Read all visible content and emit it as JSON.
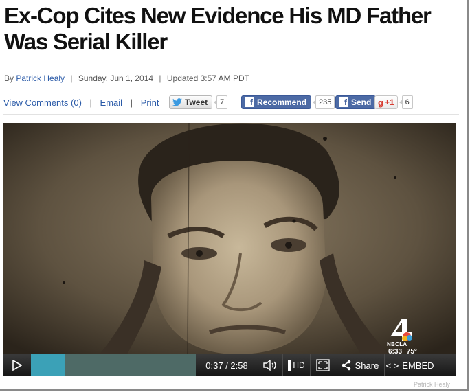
{
  "article": {
    "headline": "Ex-Cop Cites New Evidence His MD Father Was Serial Killer",
    "byline": {
      "by": "By",
      "author": "Patrick Healy",
      "date": "Sunday, Jun 1, 2014",
      "updated": "Updated 3:57 AM PDT"
    }
  },
  "actions": {
    "view_comments": "View Comments (0)",
    "email": "Email",
    "print": "Print",
    "separator": "|"
  },
  "social": {
    "tweet": {
      "label": "Tweet",
      "count": "7",
      "icon": "twitter-bird-icon"
    },
    "recommend": {
      "label": "Recommend",
      "count": "235",
      "icon": "facebook-icon"
    },
    "send": {
      "label": "Send",
      "icon": "facebook-icon"
    },
    "gplus": {
      "label": "+1",
      "count": "6",
      "icon": "google-plus-icon"
    }
  },
  "video": {
    "station_logo": {
      "name": "NBCLA",
      "time": "6:33",
      "temp": "75°"
    },
    "controls": {
      "current_time": "0:37",
      "duration": "2:58",
      "played_fraction": 0.21,
      "buffered_fraction": 1.0,
      "hd_label": "HD",
      "share_label": "Share",
      "embed_label": "EMBED"
    }
  },
  "watermark": "Patrick Healy",
  "colors": {
    "link": "#2a5aa8",
    "facebook": "#4c6aa5",
    "progress_played": "#3ba1b7"
  }
}
